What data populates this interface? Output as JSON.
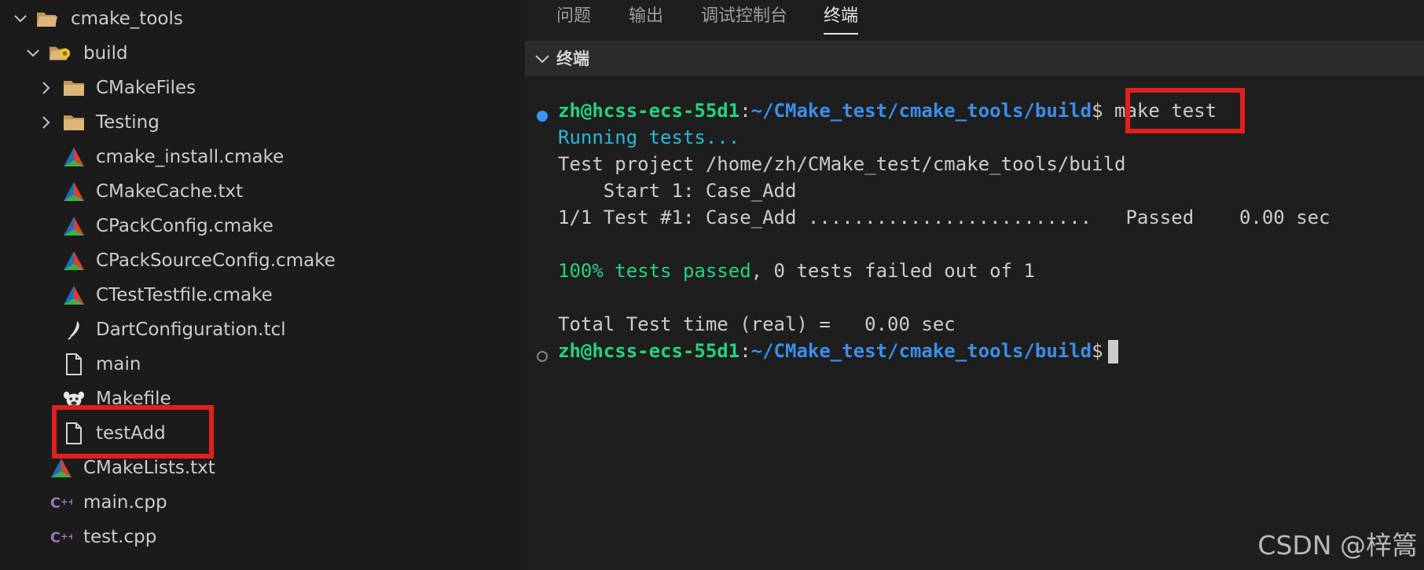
{
  "explorer": {
    "root": {
      "label": "cmake_tools",
      "icon": "folder-open-icon",
      "expanded": true
    },
    "build": {
      "label": "build",
      "icon": "folder-build-icon",
      "expanded": true
    },
    "items": [
      {
        "label": "CMakeFiles",
        "icon": "folder-icon",
        "collapsed": true
      },
      {
        "label": "Testing",
        "icon": "folder-icon",
        "collapsed": true
      },
      {
        "label": "cmake_install.cmake",
        "icon": "cmake-icon"
      },
      {
        "label": "CMakeCache.txt",
        "icon": "cmake-icon"
      },
      {
        "label": "CPackConfig.cmake",
        "icon": "cmake-icon"
      },
      {
        "label": "CPackSourceConfig.cmake",
        "icon": "cmake-icon"
      },
      {
        "label": "CTestTestfile.cmake",
        "icon": "cmake-icon"
      },
      {
        "label": "DartConfiguration.tcl",
        "icon": "tcl-feather-icon"
      },
      {
        "label": "main",
        "icon": "file-icon"
      },
      {
        "label": "Makefile",
        "icon": "makefile-icon"
      },
      {
        "label": "testAdd",
        "icon": "file-icon"
      }
    ],
    "root_files": [
      {
        "label": "CMakeLists.txt",
        "icon": "cmake-icon"
      },
      {
        "label": "main.cpp",
        "icon": "cpp-icon"
      },
      {
        "label": "test.cpp",
        "icon": "cpp-icon"
      }
    ]
  },
  "panel": {
    "tabs": [
      {
        "label": "问题",
        "active": false
      },
      {
        "label": "输出",
        "active": false
      },
      {
        "label": "调试控制台",
        "active": false
      },
      {
        "label": "终端",
        "active": true
      }
    ],
    "terminal_title": "终端"
  },
  "terminal": {
    "prompt_user": "zh@hcss-ecs-55d1",
    "prompt_colon": ":",
    "prompt_path": "~/CMake_test/cmake_tools/build",
    "prompt_dollar": "$",
    "command": " make test",
    "running": "Running tests...",
    "project_line": "Test project /home/zh/CMake_test/cmake_tools/build",
    "start_line": "    Start 1: Case_Add",
    "result_line": "1/1 Test #1: Case_Add .........................   Passed    0.00 sec",
    "summary_green": "100% tests passed",
    "summary_rest": ", 0 tests failed out of 1",
    "total_line": "Total Test time (real) =   0.00 sec",
    "colors": {
      "user": "#23d18b",
      "path": "#3b8eea",
      "cyan": "#29b8db",
      "green": "#23d18b",
      "first_prompt_dot": "#3794ff",
      "second_prompt_dot": "#848484"
    }
  },
  "highlight_color": "#e11f1f",
  "watermark": "CSDN @梓篙"
}
